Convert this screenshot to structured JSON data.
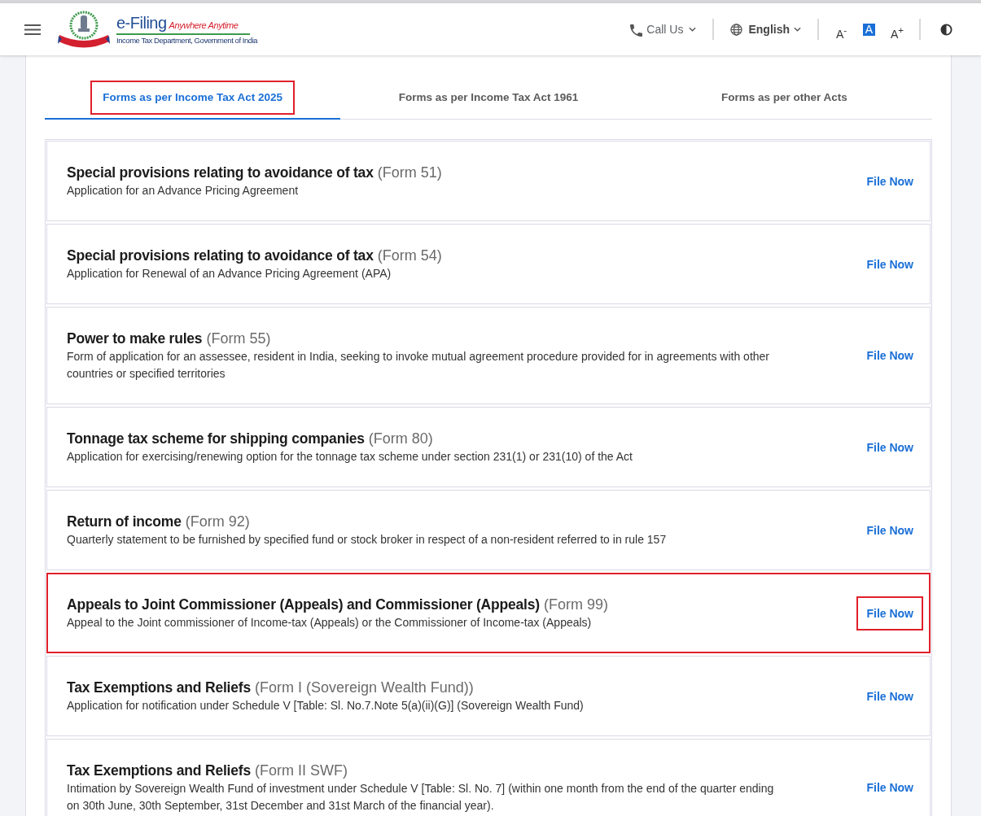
{
  "brand": {
    "title": "e-Filing",
    "tagline": "Anywhere Anytime",
    "subtitle": "Income Tax Department, Government of India"
  },
  "toolbar": {
    "call_us": "Call Us",
    "language": "English",
    "font_sizes": [
      {
        "label": "A$^{-}$",
        "selected": false
      },
      {
        "label": "A",
        "selected": true
      },
      {
        "label": "A$^{+}$",
        "selected": false
      }
    ]
  },
  "tabs": [
    {
      "label": "Forms as per Income Tax Act 2025",
      "selected": true,
      "highlighted": true
    },
    {
      "label": "Forms as per Income Tax Act 1961",
      "selected": false,
      "highlighted": false
    },
    {
      "label": "Forms as per other Acts",
      "selected": false,
      "highlighted": false
    }
  ],
  "forms": [
    {
      "title": "Special provisions relating to avoidance of tax",
      "form": "(Form 51)",
      "description": "Application for an Advance Pricing Agreement",
      "highlighted": false,
      "action": {
        "label": "File Now",
        "highlighted": false
      }
    },
    {
      "title": "Special provisions relating to avoidance of tax",
      "form": "(Form 54)",
      "description": "Application for Renewal of an Advance Pricing Agreement (APA)",
      "highlighted": false,
      "action": {
        "label": "File Now",
        "highlighted": false
      }
    },
    {
      "title": "Power to make rules",
      "form": "(Form 55)",
      "description": "Form of application for an assessee, resident in India, seeking to invoke mutual agreement procedure provided for in agreements with other countries or specified territories",
      "highlighted": false,
      "action": {
        "label": "File Now",
        "highlighted": false
      }
    },
    {
      "title": "Tonnage tax scheme for shipping companies",
      "form": "(Form 80)",
      "description": "Application for exercising/renewing option for the tonnage tax scheme under section 231(1) or 231(10) of the Act",
      "highlighted": false,
      "action": {
        "label": "File Now",
        "highlighted": false
      }
    },
    {
      "title": "Return of income",
      "form": "(Form 92)",
      "description": "Quarterly statement to be furnished by specified fund or stock broker in respect of a non-resident referred to in rule 157",
      "highlighted": false,
      "action": {
        "label": "File Now",
        "highlighted": false
      }
    },
    {
      "title": "Appeals to Joint Commissioner (Appeals) and Commissioner (Appeals)",
      "form": "(Form 99)",
      "description": "Appeal to the Joint commissioner of Income-tax (Appeals) or the Commissioner of Income-tax (Appeals)",
      "highlighted": true,
      "action": {
        "label": "File Now",
        "highlighted": true
      }
    },
    {
      "title": "Tax Exemptions and Reliefs",
      "form": "(Form I (Sovereign Wealth Fund))",
      "description": "Application for notification under Schedule V [Table: Sl. No.7.Note 5(a)(ii)(G)] (Sovereign Wealth Fund)",
      "highlighted": false,
      "action": {
        "label": "File Now",
        "highlighted": false
      }
    },
    {
      "title": "Tax Exemptions and Reliefs",
      "form": "(Form II SWF)",
      "description": "Intimation by Sovereign Wealth Fund of investment under Schedule V [Table: Sl. No. 7] (within one month from the end of the quarter ending on 30th June, 30th September, 31st December and 31st March of the financial year).",
      "highlighted": false,
      "action": {
        "label": "File Now",
        "highlighted": false
      }
    }
  ]
}
